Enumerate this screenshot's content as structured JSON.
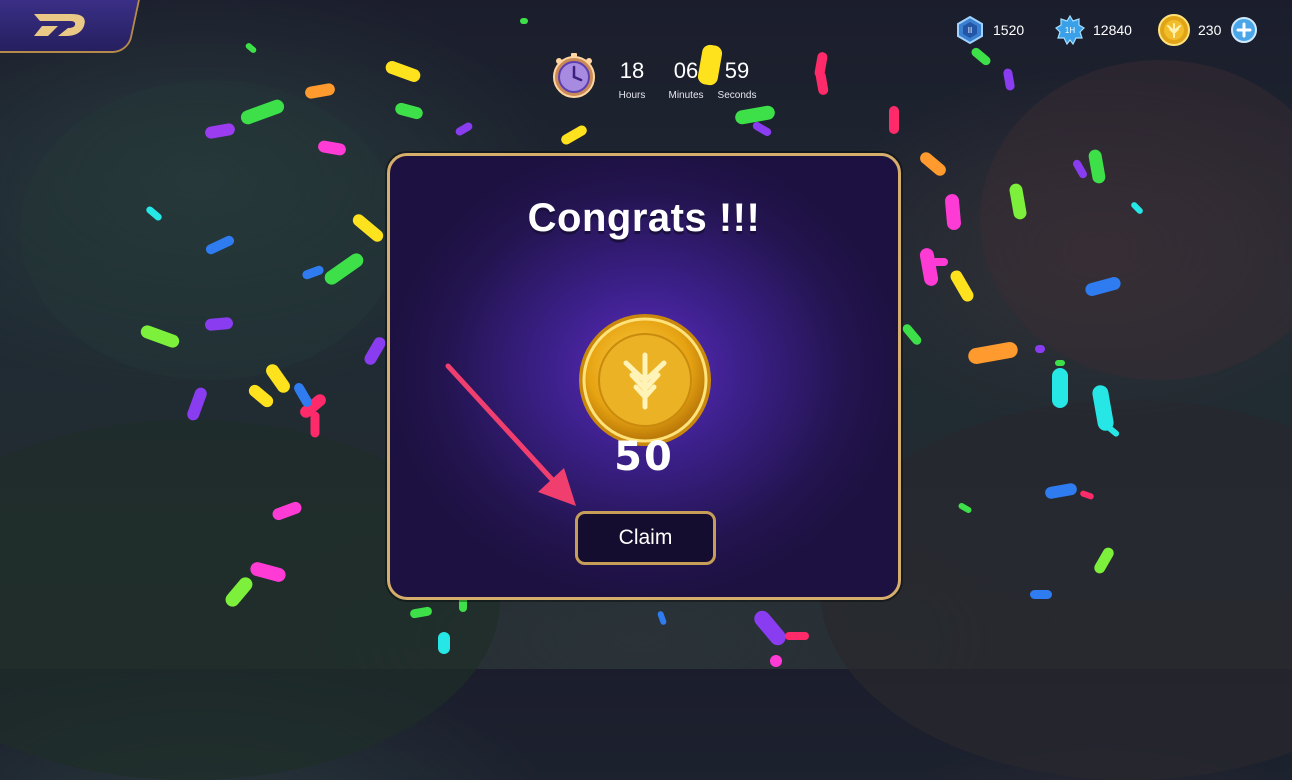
{
  "timer": {
    "hours": "18",
    "hours_label": "Hours",
    "minutes": "06",
    "minutes_label": "Minutes",
    "seconds": "59",
    "seconds_label": "Seconds"
  },
  "currencies": [
    {
      "icon": "gem-badge-icon",
      "value": "1520"
    },
    {
      "icon": "energy-badge-icon",
      "value": "12840"
    },
    {
      "icon": "gold-coin-icon",
      "value": "230"
    }
  ],
  "modal": {
    "title": "Congrats !!!",
    "reward_icon": "gold-coin-icon",
    "reward_amount": "50",
    "claim_label": "Claim"
  },
  "colors": {
    "modal_border": "#d6ae6c",
    "modal_bg": "#3a1f86",
    "button_border": "#c79e57",
    "arrow": "#f03f6e"
  }
}
